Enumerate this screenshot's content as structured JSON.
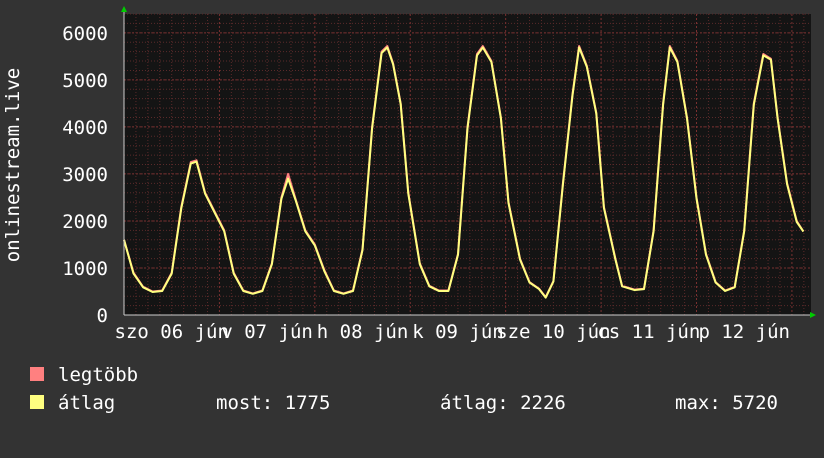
{
  "chart_data": {
    "type": "line",
    "ylabel": "onlinestream.live",
    "ylim": [
      0,
      6400
    ],
    "yticks": [
      0,
      1000,
      2000,
      3000,
      4000,
      5000,
      6000
    ],
    "ytick_labels": [
      "0",
      "1000",
      "2000",
      "3000",
      "4000",
      "5000",
      "6000"
    ],
    "x_labels": [
      "szo 06 jún",
      "v 07 jún",
      "h 08 jún",
      "k 09 jún",
      "sze 10 jún",
      "cs 11 jún",
      "p 12 jún"
    ],
    "xlim_days": [
      0,
      7.2
    ],
    "grid": true,
    "legend_placement": "bottom",
    "series": [
      {
        "name": "legtöbb",
        "color": "#ff8080",
        "points": [
          [
            0,
            1600
          ],
          [
            0.1,
            900
          ],
          [
            0.2,
            600
          ],
          [
            0.3,
            500
          ],
          [
            0.4,
            520
          ],
          [
            0.5,
            900
          ],
          [
            0.6,
            2300
          ],
          [
            0.7,
            3250
          ],
          [
            0.76,
            3290
          ],
          [
            0.85,
            2600
          ],
          [
            0.95,
            2200
          ],
          [
            1.05,
            1800
          ],
          [
            1.15,
            900
          ],
          [
            1.25,
            520
          ],
          [
            1.35,
            460
          ],
          [
            1.45,
            520
          ],
          [
            1.55,
            1100
          ],
          [
            1.65,
            2500
          ],
          [
            1.72,
            3000
          ],
          [
            1.8,
            2450
          ],
          [
            1.9,
            1800
          ],
          [
            2.0,
            1500
          ],
          [
            2.1,
            950
          ],
          [
            2.2,
            520
          ],
          [
            2.3,
            460
          ],
          [
            2.4,
            520
          ],
          [
            2.5,
            1400
          ],
          [
            2.6,
            4000
          ],
          [
            2.7,
            5600
          ],
          [
            2.76,
            5720
          ],
          [
            2.82,
            5350
          ],
          [
            2.9,
            4500
          ],
          [
            2.98,
            2600
          ],
          [
            3.1,
            1100
          ],
          [
            3.2,
            620
          ],
          [
            3.3,
            520
          ],
          [
            3.4,
            520
          ],
          [
            3.5,
            1300
          ],
          [
            3.6,
            4000
          ],
          [
            3.7,
            5550
          ],
          [
            3.76,
            5720
          ],
          [
            3.85,
            5400
          ],
          [
            3.95,
            4200
          ],
          [
            4.03,
            2400
          ],
          [
            4.15,
            1200
          ],
          [
            4.25,
            700
          ],
          [
            4.35,
            560
          ],
          [
            4.42,
            380
          ],
          [
            4.5,
            720
          ],
          [
            4.6,
            2800
          ],
          [
            4.7,
            4700
          ],
          [
            4.77,
            5720
          ],
          [
            4.85,
            5300
          ],
          [
            4.95,
            4300
          ],
          [
            5.03,
            2300
          ],
          [
            5.15,
            1200
          ],
          [
            5.22,
            620
          ],
          [
            5.35,
            540
          ],
          [
            5.45,
            560
          ],
          [
            5.55,
            1800
          ],
          [
            5.65,
            4500
          ],
          [
            5.72,
            5720
          ],
          [
            5.8,
            5400
          ],
          [
            5.9,
            4200
          ],
          [
            6.0,
            2500
          ],
          [
            6.1,
            1300
          ],
          [
            6.2,
            700
          ],
          [
            6.3,
            520
          ],
          [
            6.4,
            600
          ],
          [
            6.5,
            1800
          ],
          [
            6.6,
            4500
          ],
          [
            6.7,
            5550
          ],
          [
            6.78,
            5450
          ],
          [
            6.85,
            4200
          ],
          [
            6.95,
            2800
          ],
          [
            7.05,
            2000
          ],
          [
            7.12,
            1775
          ]
        ]
      },
      {
        "name": "átlag",
        "color": "#ffff80",
        "points": [
          [
            0,
            1600
          ],
          [
            0.1,
            880
          ],
          [
            0.2,
            590
          ],
          [
            0.3,
            490
          ],
          [
            0.4,
            510
          ],
          [
            0.5,
            880
          ],
          [
            0.6,
            2270
          ],
          [
            0.7,
            3220
          ],
          [
            0.76,
            3260
          ],
          [
            0.85,
            2580
          ],
          [
            0.95,
            2180
          ],
          [
            1.05,
            1780
          ],
          [
            1.15,
            880
          ],
          [
            1.25,
            510
          ],
          [
            1.35,
            450
          ],
          [
            1.45,
            510
          ],
          [
            1.55,
            1080
          ],
          [
            1.65,
            2470
          ],
          [
            1.72,
            2900
          ],
          [
            1.8,
            2430
          ],
          [
            1.9,
            1780
          ],
          [
            2.0,
            1480
          ],
          [
            2.1,
            930
          ],
          [
            2.2,
            510
          ],
          [
            2.3,
            450
          ],
          [
            2.4,
            510
          ],
          [
            2.5,
            1380
          ],
          [
            2.6,
            3970
          ],
          [
            2.7,
            5570
          ],
          [
            2.76,
            5690
          ],
          [
            2.82,
            5330
          ],
          [
            2.9,
            4480
          ],
          [
            2.98,
            2580
          ],
          [
            3.1,
            1080
          ],
          [
            3.2,
            610
          ],
          [
            3.3,
            510
          ],
          [
            3.4,
            510
          ],
          [
            3.5,
            1280
          ],
          [
            3.6,
            3970
          ],
          [
            3.7,
            5520
          ],
          [
            3.76,
            5690
          ],
          [
            3.85,
            5380
          ],
          [
            3.95,
            4180
          ],
          [
            4.03,
            2380
          ],
          [
            4.15,
            1180
          ],
          [
            4.25,
            690
          ],
          [
            4.35,
            550
          ],
          [
            4.42,
            370
          ],
          [
            4.5,
            710
          ],
          [
            4.6,
            2770
          ],
          [
            4.7,
            4670
          ],
          [
            4.77,
            5690
          ],
          [
            4.85,
            5280
          ],
          [
            4.95,
            4280
          ],
          [
            5.03,
            2280
          ],
          [
            5.15,
            1180
          ],
          [
            5.22,
            610
          ],
          [
            5.35,
            530
          ],
          [
            5.45,
            550
          ],
          [
            5.55,
            1780
          ],
          [
            5.65,
            4470
          ],
          [
            5.72,
            5690
          ],
          [
            5.8,
            5380
          ],
          [
            5.9,
            4180
          ],
          [
            6.0,
            2480
          ],
          [
            6.1,
            1280
          ],
          [
            6.2,
            690
          ],
          [
            6.3,
            510
          ],
          [
            6.4,
            590
          ],
          [
            6.5,
            1780
          ],
          [
            6.6,
            4470
          ],
          [
            6.7,
            5520
          ],
          [
            6.78,
            5430
          ],
          [
            6.85,
            4180
          ],
          [
            6.95,
            2780
          ],
          [
            7.05,
            1980
          ],
          [
            7.12,
            1775
          ]
        ]
      }
    ]
  },
  "legend": {
    "items": [
      {
        "label": "legtöbb",
        "color": "#ff8080"
      },
      {
        "label": "átlag",
        "color": "#ffff80"
      }
    ]
  },
  "stats": {
    "now": "most: 1775",
    "avg": "átlag: 2226",
    "max": "max: 5720"
  },
  "colors": {
    "background": "#333333",
    "plot_background": "#141414",
    "grid": "#5a2a2a",
    "axis_arrow": "#00cc00"
  }
}
